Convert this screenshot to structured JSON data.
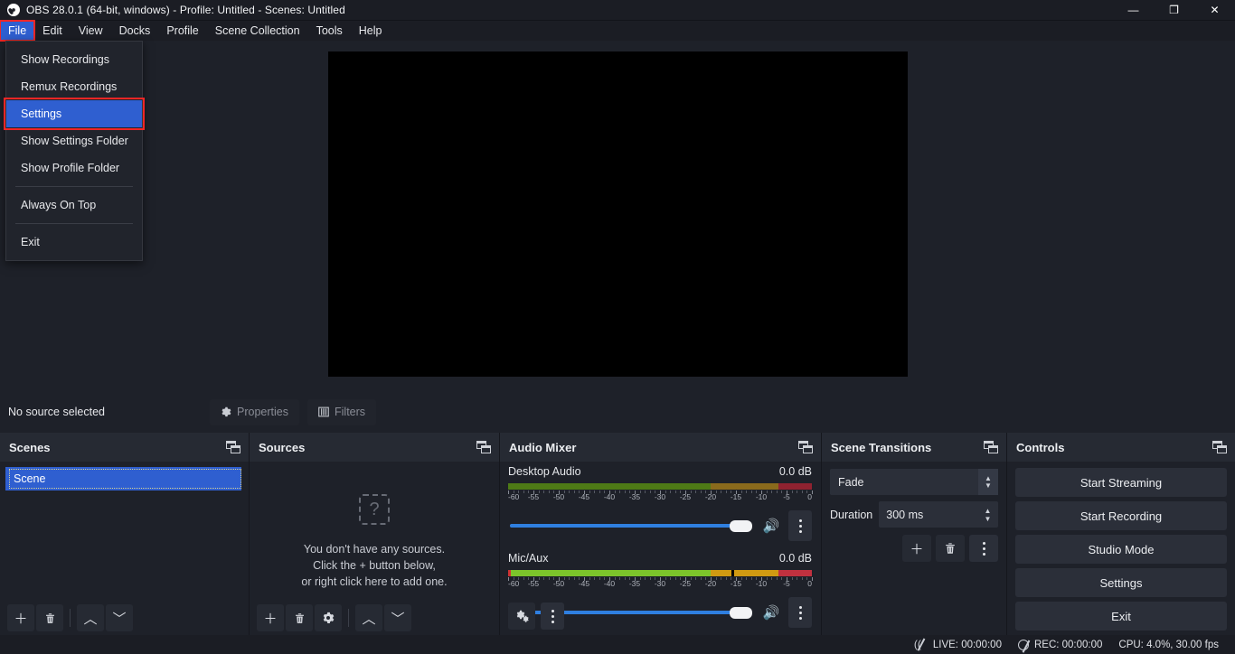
{
  "window": {
    "title": "OBS 28.0.1 (64-bit, windows) - Profile: Untitled - Scenes: Untitled",
    "minimize": "—",
    "maximize": "❐",
    "close": "✕"
  },
  "menubar": {
    "items": [
      {
        "label": "File",
        "active": true
      },
      {
        "label": "Edit",
        "active": false
      },
      {
        "label": "View",
        "active": false
      },
      {
        "label": "Docks",
        "active": false
      },
      {
        "label": "Profile",
        "active": false
      },
      {
        "label": "Scene Collection",
        "active": false
      },
      {
        "label": "Tools",
        "active": false
      },
      {
        "label": "Help",
        "active": false
      }
    ]
  },
  "file_menu": {
    "items": [
      {
        "label": "Show Recordings",
        "selected": false,
        "separator_after": false
      },
      {
        "label": "Remux Recordings",
        "selected": false,
        "separator_after": false
      },
      {
        "label": "Settings",
        "selected": true,
        "separator_after": false
      },
      {
        "label": "Show Settings Folder",
        "selected": false,
        "separator_after": false
      },
      {
        "label": "Show Profile Folder",
        "selected": false,
        "separator_after": true
      },
      {
        "label": "Always On Top",
        "selected": false,
        "separator_after": true
      },
      {
        "label": "Exit",
        "selected": false,
        "separator_after": false
      }
    ]
  },
  "source_toolbar": {
    "status": "No source selected",
    "properties_label": "Properties",
    "properties_icon": "gear-icon",
    "filters_label": "Filters",
    "filters_icon": "filters-icon"
  },
  "scenes": {
    "title": "Scenes",
    "items": [
      "Scene"
    ],
    "tools": [
      "add-icon",
      "remove-icon",
      "move-up-icon",
      "move-down-icon"
    ]
  },
  "sources": {
    "title": "Sources",
    "empty_icon": "?",
    "empty_line1": "You don't have any sources.",
    "empty_line2": "Click the + button below,",
    "empty_line3": "or right click here to add one.",
    "tools": [
      "add-icon",
      "remove-icon",
      "gear-icon",
      "move-up-icon",
      "move-down-icon"
    ]
  },
  "audio_mixer": {
    "title": "Audio Mixer",
    "scale_labels": [
      "-60",
      "-55",
      "-50",
      "-45",
      "-40",
      "-35",
      "-30",
      "-25",
      "-20",
      "-15",
      "-10",
      "-5",
      "0"
    ],
    "channels": [
      {
        "name": "Desktop Audio",
        "db": "0.0 dB",
        "dim": true,
        "volume_pct": 100,
        "peak_db": null,
        "muted": false
      },
      {
        "name": "Mic/Aux",
        "db": "0.0 dB",
        "dim": false,
        "volume_pct": 100,
        "peak_db": -16,
        "muted": false
      }
    ],
    "tools": [
      "audio-settings-icon",
      "menu-icon"
    ]
  },
  "scene_transitions": {
    "title": "Scene Transitions",
    "transition": "Fade",
    "duration_label": "Duration",
    "duration_value": "300 ms",
    "tools": [
      "add-icon",
      "remove-icon",
      "menu-icon"
    ]
  },
  "controls": {
    "title": "Controls",
    "buttons": [
      "Start Streaming",
      "Start Recording",
      "Studio Mode",
      "Settings",
      "Exit"
    ]
  },
  "statusbar": {
    "live_label": "LIVE: 00:00:00",
    "rec_label": "REC: 00:00:00",
    "perf_label": "CPU: 4.0%, 30.00 fps"
  },
  "colors": {
    "accent": "#2f5fd0",
    "annotation": "#ef2626",
    "panel": "#1e2129",
    "dock_header": "#262a33",
    "slider": "#2f7fe0"
  }
}
